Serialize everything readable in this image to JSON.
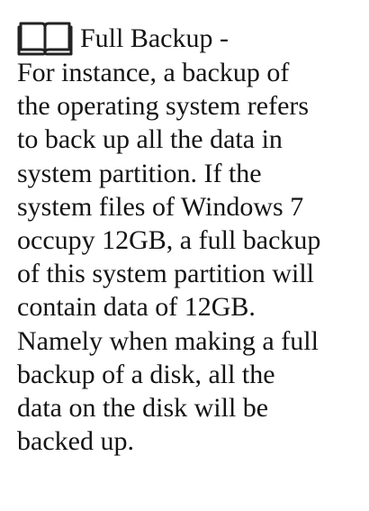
{
  "entry": {
    "icon": "open-book-icon",
    "title": "Full Backup -",
    "lines": [
      "For instance, a backup of",
      "the operating system refers",
      "to back up all the data in",
      "system partition. If the",
      "system files of Windows 7",
      "occupy 12GB, a full backup",
      "of this system partition will",
      "contain data of 12GB.",
      "Namely when making a full",
      "backup of a disk, all the",
      "data on the disk will be",
      "backed up."
    ]
  },
  "colors": {
    "text": "#141414",
    "background": "#ffffff"
  }
}
